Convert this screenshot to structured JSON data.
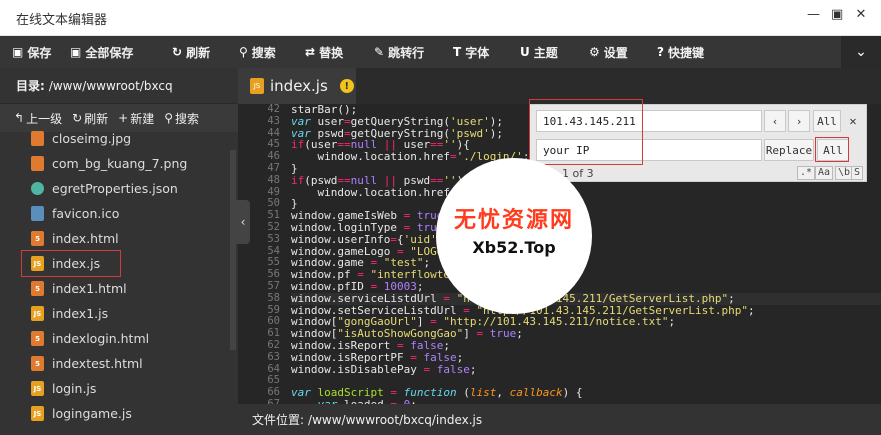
{
  "window": {
    "title": "在线文本编辑器",
    "controls": [
      "—",
      "▣",
      "✕"
    ]
  },
  "toolbar": {
    "save": "保存",
    "save_all": "全部保存",
    "refresh": "刷新",
    "search": "搜索",
    "replace": "替换",
    "goto_line": "跳转行",
    "font": "字体",
    "theme": "主题",
    "settings": "设置",
    "shortcuts": "快捷键",
    "collapse_icon": "chevron-down"
  },
  "sidebar": {
    "path_label": "目录:",
    "path_value": "/www/wwwroot/bxcq",
    "actions": {
      "up": "上一级",
      "refresh": "刷新",
      "new": "新建",
      "search": "搜索"
    },
    "files": [
      {
        "name": "closeimg.jpg",
        "type": "img"
      },
      {
        "name": "com_bg_kuang_7.png",
        "type": "img"
      },
      {
        "name": "egretProperties.json",
        "type": "json"
      },
      {
        "name": "favicon.ico",
        "type": "ico"
      },
      {
        "name": "index.html",
        "type": "html"
      },
      {
        "name": "index.js",
        "type": "js",
        "selected": true
      },
      {
        "name": "index1.html",
        "type": "html"
      },
      {
        "name": "index1.js",
        "type": "js"
      },
      {
        "name": "indexlogin.html",
        "type": "html"
      },
      {
        "name": "indextest.html",
        "type": "html"
      },
      {
        "name": "login.js",
        "type": "js"
      },
      {
        "name": "logingame.js",
        "type": "js"
      }
    ]
  },
  "tab": {
    "label": "index.js",
    "badge": "JS",
    "warning": "!"
  },
  "editor": {
    "line_numbers": [
      "42",
      "43",
      "44",
      "45",
      "46",
      "47",
      "48",
      "49",
      "50",
      "51",
      "52",
      "53",
      "54",
      "55",
      "56",
      "57",
      "58",
      "59",
      "60",
      "61",
      "62",
      "63",
      "64",
      "65",
      "66",
      "67"
    ]
  },
  "find": {
    "search_value": "101.43.145.211",
    "replace_value": "your IP",
    "all_label": "All",
    "replace_label": "Replace",
    "replace_all_label": "All",
    "count": "1 of 3",
    "options": [
      ".*",
      "Aa",
      "\\b",
      "S"
    ]
  },
  "statusbar": {
    "label": "文件位置:",
    "value": "/www/wwwroot/bxcq/index.js"
  },
  "watermark": {
    "cn": "无忧资源网",
    "en": "Xb52.Top"
  },
  "colors": {
    "toolbar_bg": "#363636",
    "sidebar_bg": "#333333",
    "editor_bg": "#262626",
    "highlight": "#d23b3b"
  }
}
